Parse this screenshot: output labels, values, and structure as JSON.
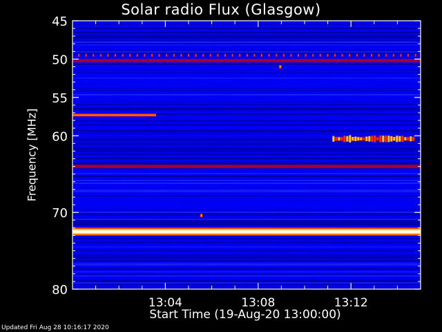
{
  "title": "Solar radio Flux (Glasgow)",
  "updated": "Updated Fri Aug 28 10:16:17 2020",
  "chart_data": {
    "type": "heatmap",
    "title": "Solar radio Flux (Glasgow)",
    "xlabel": "Start Time (19-Aug-20 13:00:00)",
    "ylabel": "Frequency [MHz]",
    "x_range_minutes": [
      0,
      15
    ],
    "ylim": [
      45,
      80
    ],
    "y_inverted": true,
    "x_ticks": [
      {
        "value": 4,
        "label": "13:04"
      },
      {
        "value": 8,
        "label": "13:08"
      },
      {
        "value": 12,
        "label": "13:12"
      }
    ],
    "y_ticks": [
      {
        "value": 45,
        "label": "45"
      },
      {
        "value": 50,
        "label": "50"
      },
      {
        "value": 55,
        "label": "55"
      },
      {
        "value": 60,
        "label": "60"
      },
      {
        "value": 70,
        "label": "70"
      },
      {
        "value": 80,
        "label": "80"
      }
    ],
    "colormap": [
      "#000060",
      "#0000ff",
      "#a00030",
      "#ff3000",
      "#ffd000",
      "#ffffff"
    ],
    "features": [
      {
        "kind": "band",
        "freq_mhz": 72.5,
        "t_start": 0,
        "t_end": 15,
        "intensity": "very high"
      },
      {
        "kind": "band",
        "freq_mhz": 64.0,
        "t_start": 0,
        "t_end": 15,
        "intensity": "medium"
      },
      {
        "kind": "band",
        "freq_mhz": 50.2,
        "t_start": 0,
        "t_end": 15,
        "intensity": "medium"
      },
      {
        "kind": "periodic-dots",
        "freq_mhz": 49.5,
        "t_start": 0,
        "t_end": 15,
        "intensity": "medium"
      },
      {
        "kind": "band",
        "freq_mhz": 57.3,
        "t_start": 0,
        "t_end": 3.6,
        "intensity": "high"
      },
      {
        "kind": "burst",
        "freq_mhz": 60.4,
        "t_start": 11.2,
        "t_end": 14.7,
        "intensity": "high"
      },
      {
        "kind": "spot",
        "freq_mhz": 51.0,
        "t_start": 8.9,
        "t_end": 9.0,
        "intensity": "high"
      },
      {
        "kind": "spot",
        "freq_mhz": 70.4,
        "t_start": 5.5,
        "t_end": 5.6,
        "intensity": "high"
      }
    ]
  }
}
